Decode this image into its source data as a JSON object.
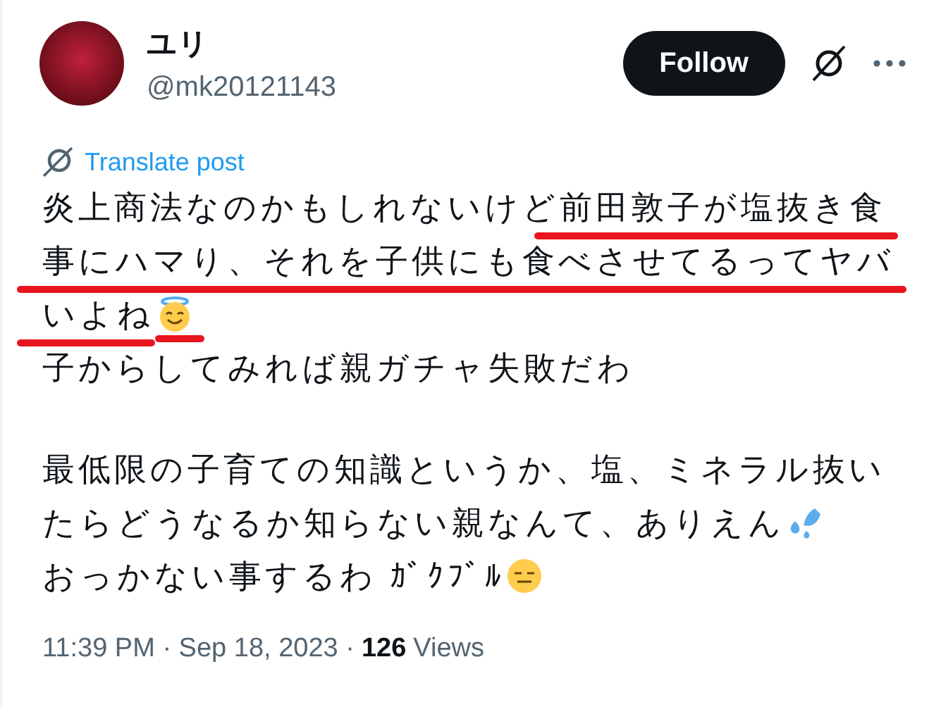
{
  "author": {
    "name": "ユリ",
    "handle": "@mk20121143"
  },
  "follow_button": "Follow",
  "translate_link": "Translate post",
  "body": {
    "paragraphs": [
      {
        "lines": [
          {
            "segments": [
              {
                "kind": "text",
                "text": "炎上商法なのかもしれないけど",
                "underlined": false
              },
              {
                "kind": "text",
                "text": "前田敦子が塩抜き食",
                "underlined": true
              }
            ]
          },
          {
            "segments": [
              {
                "kind": "text",
                "text": "事にハマり、それを子供にも食べさせてるってヤバ",
                "underlined": true
              }
            ]
          },
          {
            "segments": [
              {
                "kind": "text",
                "text": "いよね",
                "underlined": true
              },
              {
                "kind": "halo",
                "underlined": true
              }
            ]
          },
          {
            "segments": [
              {
                "kind": "text",
                "text": "子からしてみれば親ガチャ失敗だわ",
                "underlined": false
              }
            ]
          }
        ]
      },
      {
        "lines": [
          {
            "segments": [
              {
                "kind": "text",
                "text": "最低限の子育ての知識というか、塩、ミネラル抜い",
                "underlined": false
              }
            ]
          },
          {
            "segments": [
              {
                "kind": "text",
                "text": "たらどうなるか知らない親なんて、ありえん",
                "underlined": false
              },
              {
                "kind": "sweat",
                "underlined": false
              }
            ]
          },
          {
            "segments": [
              {
                "kind": "text",
                "text": "おっかない事するわ ｶﾞｸﾌﾞﾙ",
                "underlined": false
              },
              {
                "kind": "expressionless",
                "underlined": false
              }
            ]
          }
        ]
      }
    ]
  },
  "footer": {
    "time": "11:39 PM · Sep 18, 2023 ·",
    "views_count": "126",
    "views_label": "Views"
  }
}
